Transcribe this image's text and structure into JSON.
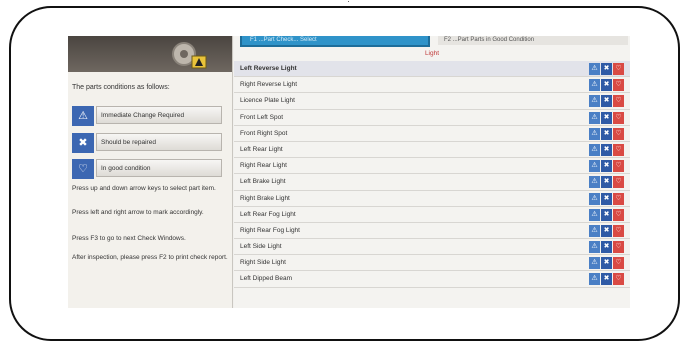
{
  "left_panel": {
    "intro": "The parts conditions as follows:",
    "legend": [
      {
        "icon": "warning-icon",
        "label": "Immediate Change Required"
      },
      {
        "icon": "cross-icon",
        "label": "Should be repaired"
      },
      {
        "icon": "good-icon",
        "label": "In good condition"
      }
    ],
    "instructions": [
      "Press up and down arrow keys to select part item.",
      "Press left and right arrow to mark accordingly.",
      "Press F3 to go to next Check Windows.",
      "After inspection, please press F2 to print check report."
    ]
  },
  "tabs": [
    "F1 ...Part Check... Select",
    "F2 ...Part Parts in Good Condition"
  ],
  "section_title": "Light",
  "rows": [
    "Left Reverse Light",
    "Right Reverse Light",
    "Licence Plate Light",
    "Front Left Spot",
    "Front Right Spot",
    "Left Rear Light",
    "Right Rear Light",
    "Left Brake Light",
    "Right Brake Light",
    "Left Rear Fog Light",
    "Right Rear Fog Light",
    "Left Side Light",
    "Right Side Light",
    "Left Dipped Beam"
  ],
  "selected_row": 0,
  "colors": {
    "tab_active": "#2f93c9",
    "warn": "#4a7fc5",
    "repair": "#2f5aa6",
    "good": "#d94a44",
    "title": "#c03a3a"
  }
}
